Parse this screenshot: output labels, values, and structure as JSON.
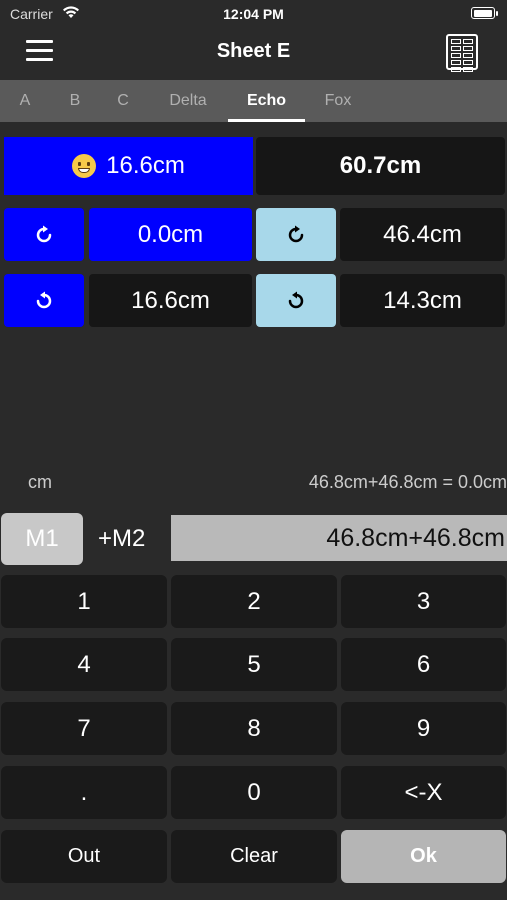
{
  "status_bar": {
    "carrier": "Carrier",
    "time": "12:04 PM",
    "battery_level": 1.0
  },
  "nav": {
    "title": "Sheet E",
    "menu_icon": "hamburger-menu-icon",
    "sheet_icon": "spreadsheet-grid-icon"
  },
  "tabs": [
    {
      "label": "A"
    },
    {
      "label": "B"
    },
    {
      "label": "C"
    },
    {
      "label": "Delta"
    },
    {
      "label": "Echo",
      "active": true
    },
    {
      "label": "Fox"
    }
  ],
  "measurements": {
    "primary": {
      "emoji": "grinning-face-icon",
      "value": "16.6cm",
      "total": "60.7cm"
    },
    "rotate_cw": {
      "icon": "rotate-clockwise-icon",
      "left_value": "0.0cm",
      "right_value": "46.4cm"
    },
    "rotate_ccw": {
      "icon": "rotate-counterclockwise-icon",
      "left_value": "16.6cm",
      "right_value": "14.3cm"
    }
  },
  "calculator": {
    "unit": "cm",
    "expression_result": "46.8cm+46.8cm = 0.0cm",
    "m1_label": "M1",
    "m2_label": "+M2",
    "input": "46.8cm+46.8cm"
  },
  "keypad": {
    "rows": [
      [
        "1",
        "2",
        "3"
      ],
      [
        "4",
        "5",
        "6"
      ],
      [
        "7",
        "8",
        "9"
      ],
      [
        ".",
        "0",
        "<-X"
      ],
      [
        "Out",
        "Clear",
        "Ok"
      ]
    ]
  },
  "colors": {
    "active_blue": "#0000ff",
    "light_blue": "#a8d8ea",
    "background": "#2a2a2a"
  }
}
